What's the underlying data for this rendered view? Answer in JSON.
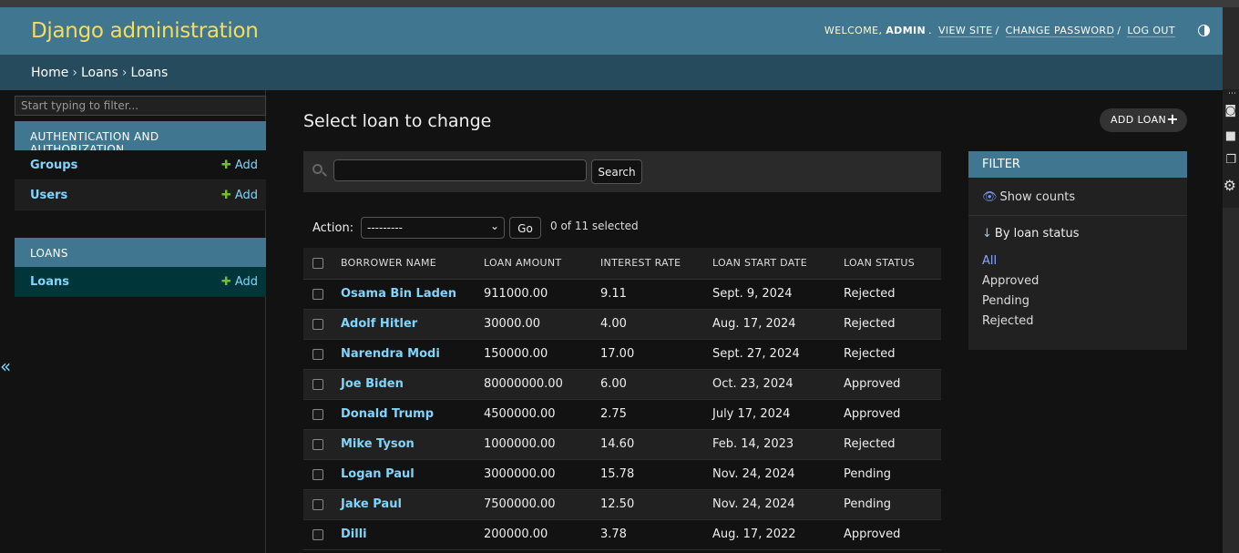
{
  "header": {
    "brand": "Django administration",
    "welcome": "WELCOME,",
    "username": "ADMIN",
    "view_site": "VIEW SITE",
    "change_password": "CHANGE PASSWORD",
    "log_out": "LOG OUT"
  },
  "breadcrumbs": [
    "Home",
    "Loans",
    "Loans"
  ],
  "sidebar": {
    "filter_placeholder": "Start typing to filter...",
    "modules": [
      {
        "title": "AUTHENTICATION AND AUTHORIZATION",
        "items": [
          {
            "label": "Groups",
            "add": "Add"
          },
          {
            "label": "Users",
            "add": "Add"
          }
        ]
      },
      {
        "title": "LOANS",
        "items": [
          {
            "label": "Loans",
            "add": "Add"
          }
        ]
      }
    ],
    "collapse": "«"
  },
  "content": {
    "title": "Select loan to change",
    "add_button": "ADD LOAN",
    "search_button": "Search",
    "action_label": "Action:",
    "action_value": "---------",
    "go_button": "Go",
    "selected_count": "0 of 11 selected",
    "columns": [
      "BORROWER NAME",
      "LOAN AMOUNT",
      "INTEREST RATE",
      "LOAN START DATE",
      "LOAN STATUS"
    ],
    "rows": [
      [
        "Osama Bin Laden",
        "911000.00",
        "9.11",
        "Sept. 9, 2024",
        "Rejected"
      ],
      [
        "Adolf Hitler",
        "30000.00",
        "4.00",
        "Aug. 17, 2024",
        "Rejected"
      ],
      [
        "Narendra Modi",
        "150000.00",
        "17.00",
        "Sept. 27, 2024",
        "Rejected"
      ],
      [
        "Joe Biden",
        "80000000.00",
        "6.00",
        "Oct. 23, 2024",
        "Approved"
      ],
      [
        "Donald Trump",
        "4500000.00",
        "2.75",
        "July 17, 2024",
        "Approved"
      ],
      [
        "Mike Tyson",
        "1000000.00",
        "14.60",
        "Feb. 14, 2023",
        "Rejected"
      ],
      [
        "Logan Paul",
        "3000000.00",
        "15.78",
        "Nov. 24, 2024",
        "Pending"
      ],
      [
        "Jake Paul",
        "7500000.00",
        "12.50",
        "Nov. 24, 2024",
        "Pending"
      ],
      [
        "Dilli",
        "200000.00",
        "3.78",
        "Aug. 17, 2022",
        "Approved"
      ]
    ]
  },
  "filter": {
    "title": "FILTER",
    "show_counts": "Show counts",
    "by_label": "By loan status",
    "options": [
      "All",
      "Approved",
      "Pending",
      "Rejected"
    ]
  },
  "colors": {
    "header_bg": "#417690",
    "brand": "#f5dd5d",
    "breadcrumb_bg": "#264b5d",
    "link": "#81d4fa",
    "add_plus": "#70bf2b"
  }
}
